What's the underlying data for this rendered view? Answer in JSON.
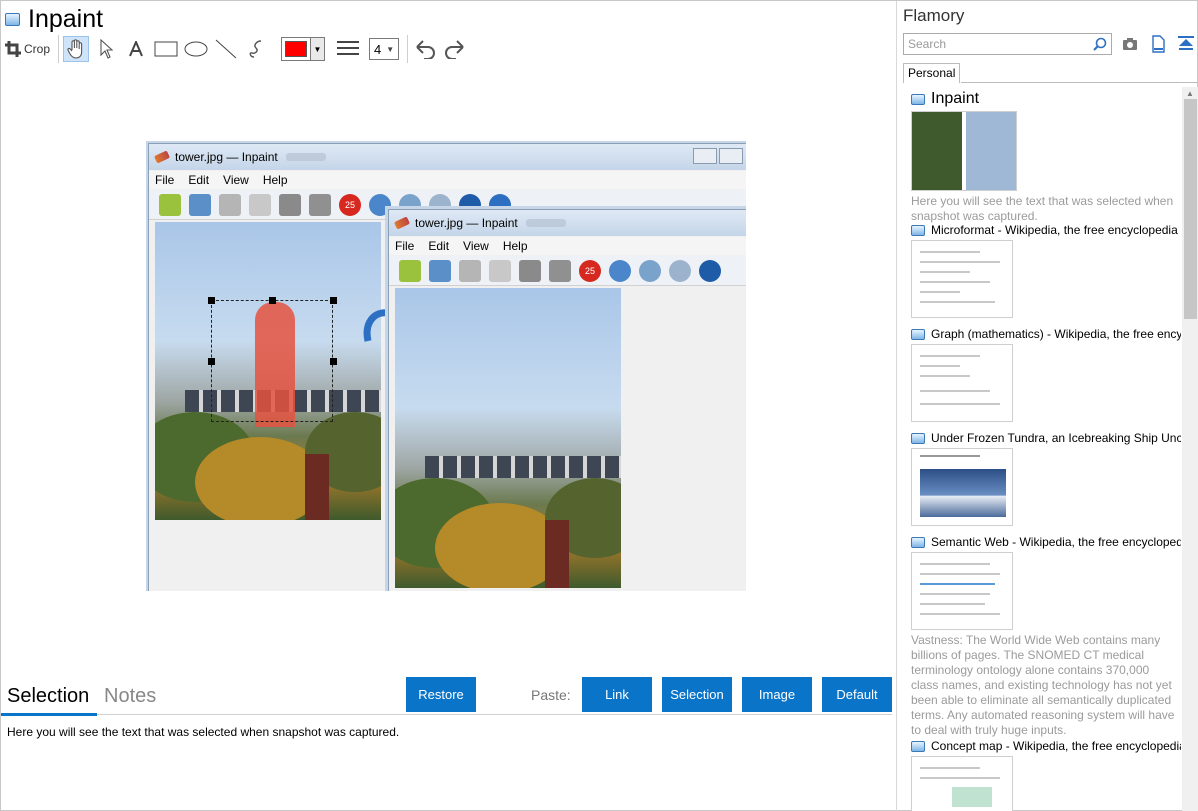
{
  "app": {
    "title": "Inpaint"
  },
  "toolbar": {
    "crop_label": "Crop",
    "tool_icons": [
      "hand-icon",
      "arrow-pointer-icon",
      "text-icon",
      "rectangle-icon",
      "ellipse-icon",
      "line-icon",
      "freehand-icon"
    ],
    "color": "#ff0000",
    "stroke_width": "4"
  },
  "snapshot": {
    "window_title": "tower.jpg — Inpaint",
    "menu": [
      "File",
      "Edit",
      "View",
      "Help"
    ],
    "badge": "25"
  },
  "tabs": {
    "selection": "Selection",
    "notes": "Notes"
  },
  "buttons": {
    "restore": "Restore",
    "paste_label": "Paste:",
    "link": "Link",
    "selection": "Selection",
    "image": "Image",
    "default": "Default"
  },
  "selection_text": "Here you will see the text that was selected when snapshot was captured.",
  "side": {
    "title": "Flamory",
    "search_placeholder": "Search",
    "tab": "Personal",
    "entries": [
      {
        "title": "Inpaint",
        "desc": "Here you will see the text that was selected when snapshot was captured."
      },
      {
        "title": "Microformat - Wikipedia, the free encyclopedia",
        "desc": ""
      },
      {
        "title": "Graph (mathematics) - Wikipedia, the free ency",
        "desc": ""
      },
      {
        "title": "Under Frozen Tundra, an Icebreaking Ship Unco",
        "desc": ""
      },
      {
        "title": "Semantic Web - Wikipedia, the free encycloped",
        "desc": "Vastness: The World Wide Web contains many billions of pages. The SNOMED CT medical terminology ontology alone contains 370,000 class names, and existing technology has not yet been able to eliminate all semantically duplicated terms. Any automated reasoning system will have to deal with truly huge inputs."
      },
      {
        "title": "Concept map - Wikipedia, the free encyclopedia",
        "desc": ""
      }
    ]
  },
  "colors": {
    "accent": "#0a74c9",
    "brush": "#ff0000"
  }
}
